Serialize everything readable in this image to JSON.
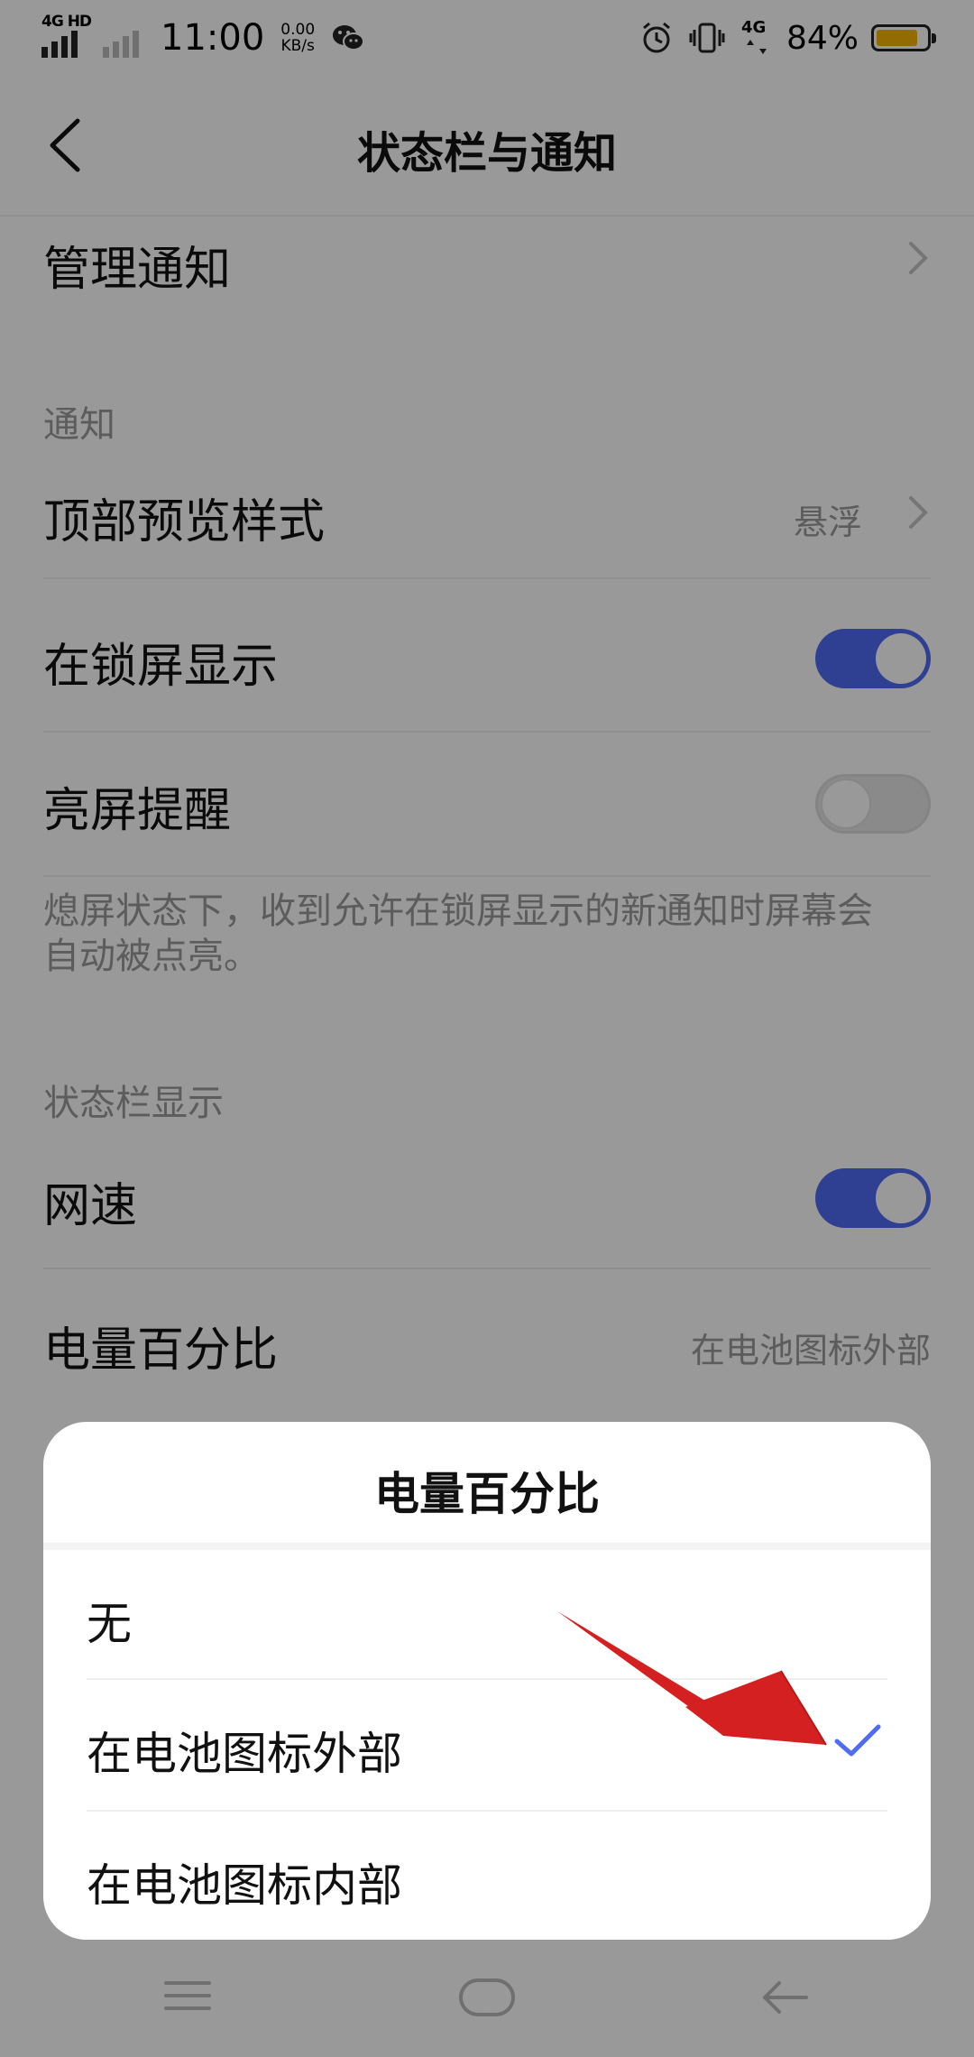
{
  "status_bar": {
    "network_label": "4G HD",
    "time": "11:00",
    "net_speed_value": "0.00",
    "net_speed_unit": "KB/s",
    "network2_label": "4G",
    "battery_percent": "84%",
    "battery_level": 0.84,
    "icons": [
      "signal-icon",
      "wechat-icon",
      "alarm-icon",
      "vibrate-icon",
      "data-icon",
      "battery-icon"
    ]
  },
  "header": {
    "title": "状态栏与通知"
  },
  "list": {
    "manage_notifications": "管理通知",
    "section_notifications": "通知",
    "preview_style": {
      "label": "顶部预览样式",
      "value": "悬浮"
    },
    "show_on_lockscreen": {
      "label": "在锁屏显示",
      "enabled": true
    },
    "wake_screen": {
      "label": "亮屏提醒",
      "enabled": false
    },
    "wake_desc": "熄屏状态下，收到允许在锁屏显示的新通知时屏幕会自动被点亮。",
    "section_statusbar": "状态栏显示",
    "net_speed": {
      "label": "网速",
      "enabled": true
    },
    "battery_percentage": {
      "label": "电量百分比",
      "value": "在电池图标外部"
    }
  },
  "sheet": {
    "title": "电量百分比",
    "options": [
      {
        "label": "无",
        "selected": false
      },
      {
        "label": "在电池图标外部",
        "selected": true
      },
      {
        "label": "在电池图标内部",
        "selected": false
      }
    ]
  },
  "colors": {
    "accent": "#4f6cf5",
    "battery_fill": "#f4b400",
    "annotation_arrow": "#d42020"
  }
}
